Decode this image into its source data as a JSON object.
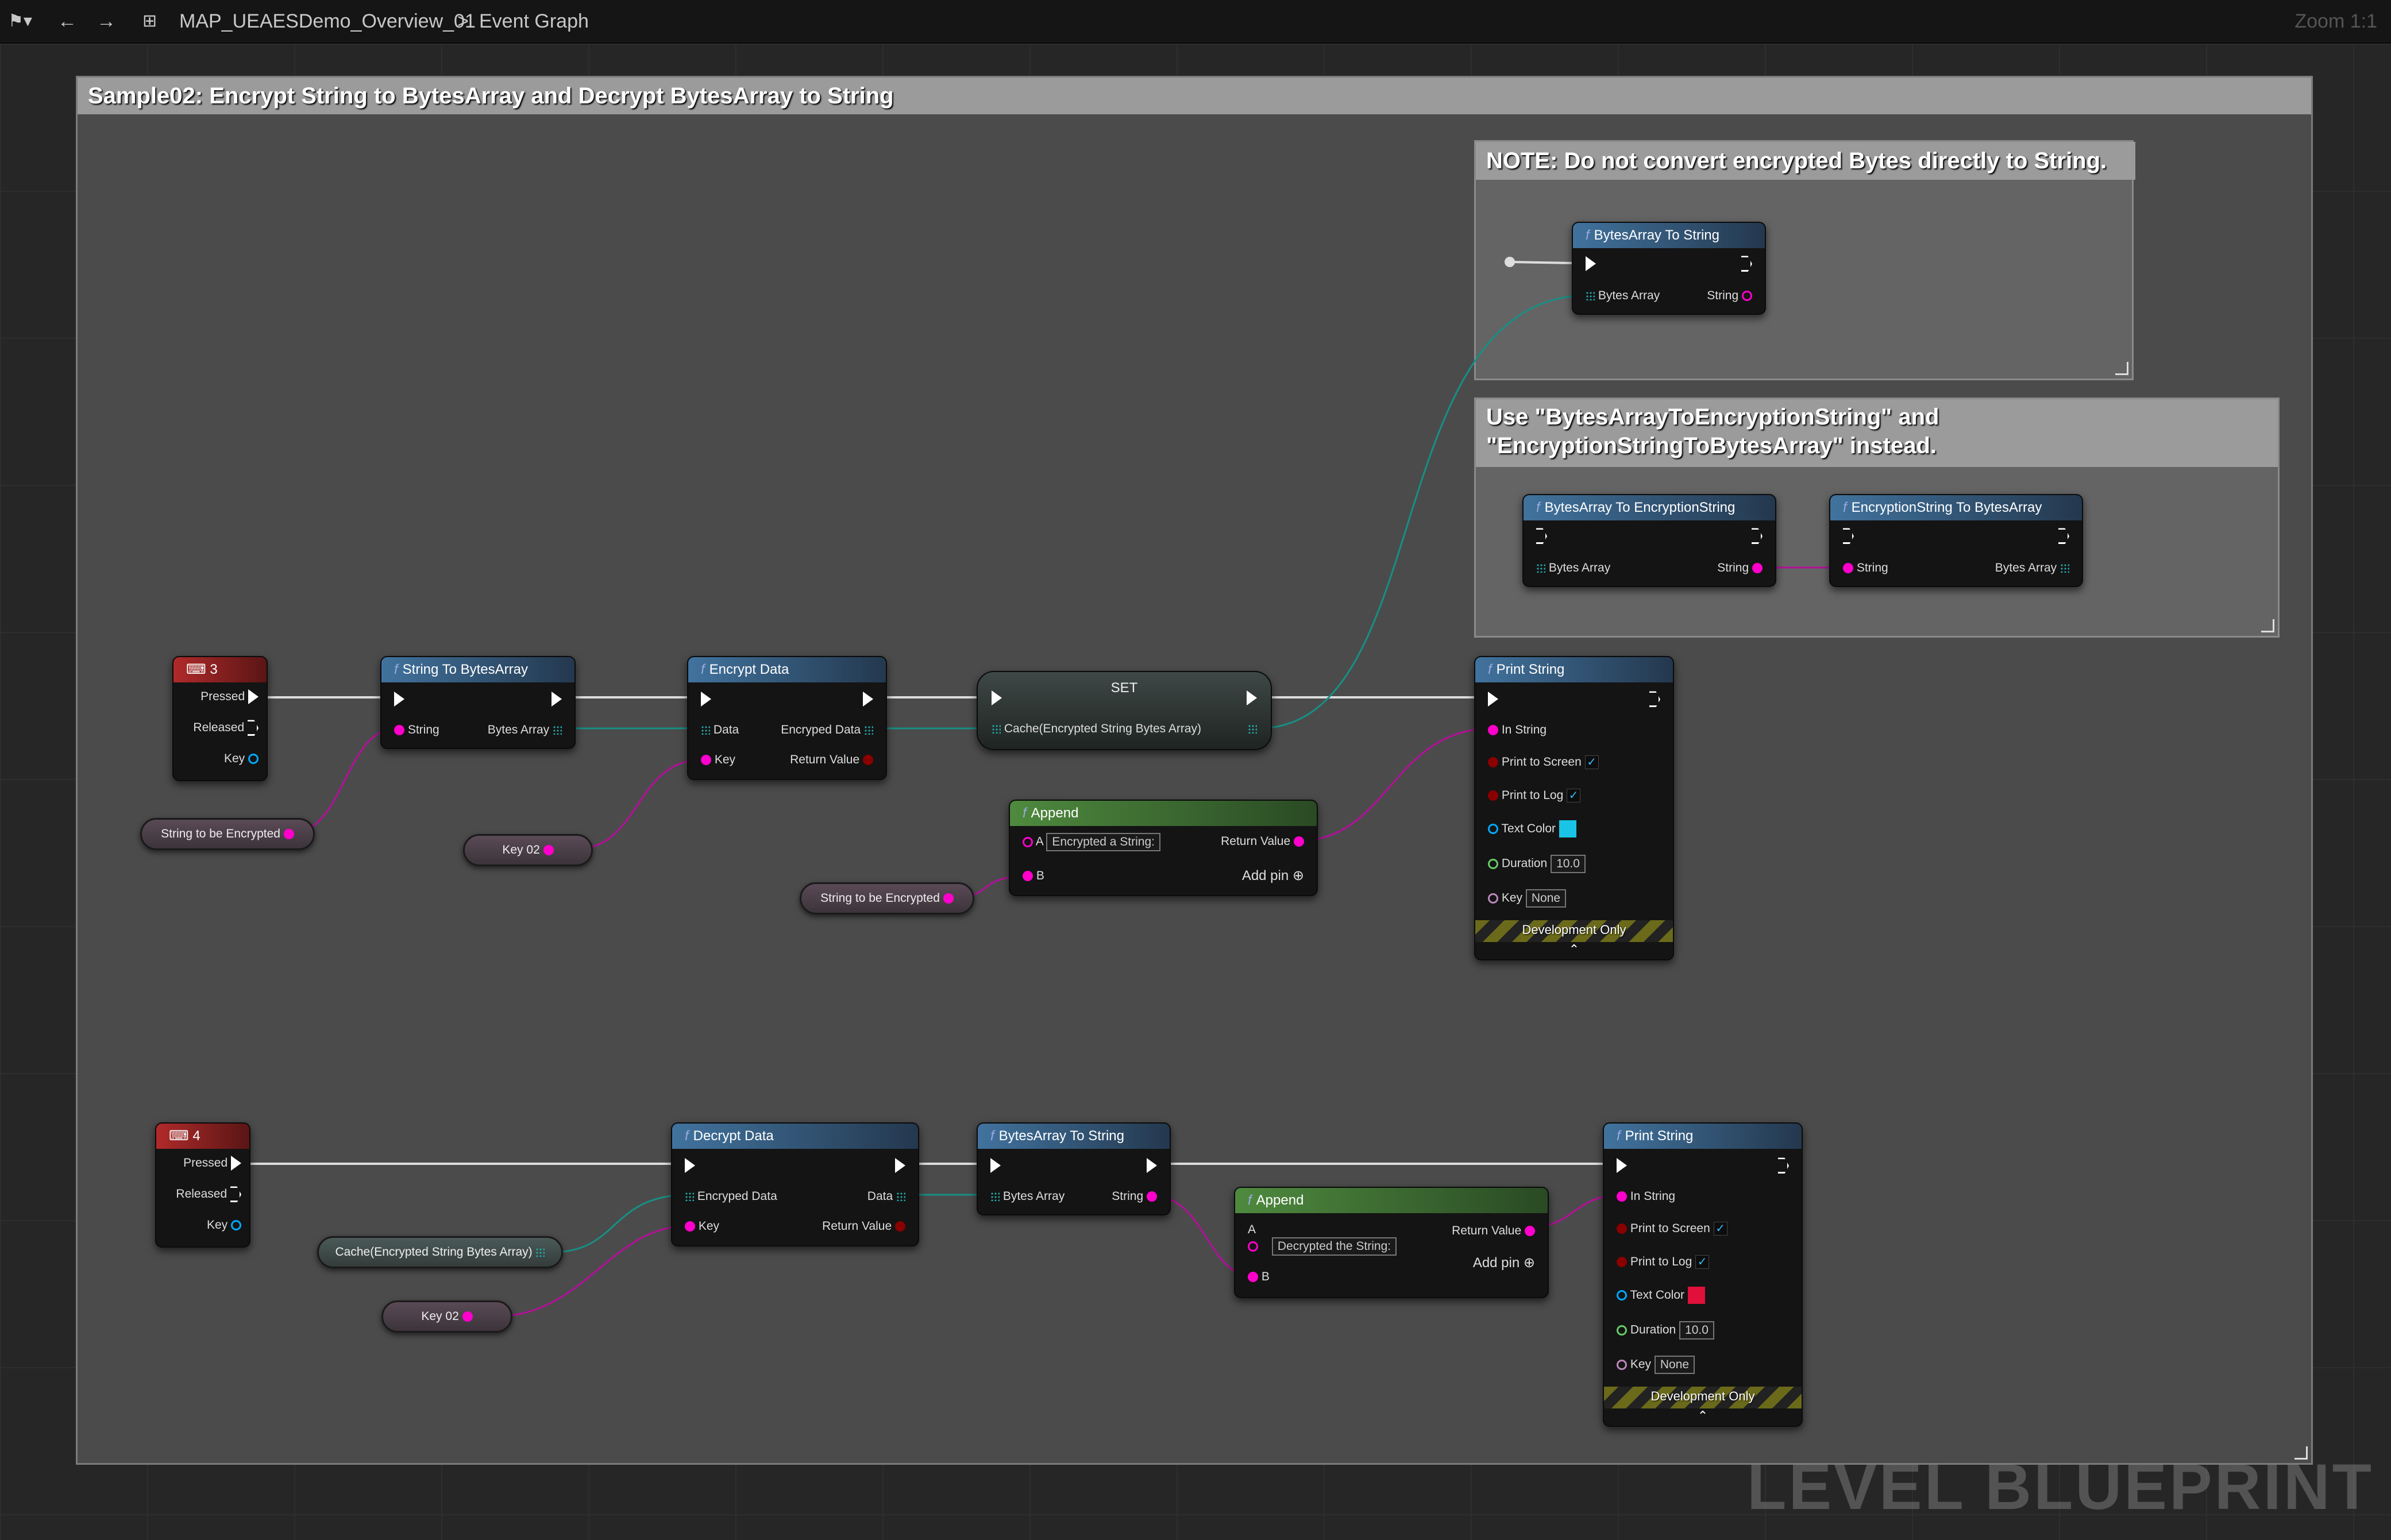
{
  "toolbar": {
    "breadcrumb_map": "MAP_UEAESDemo_Overview_01",
    "breadcrumb_sep": ">",
    "breadcrumb_graph": "Event Graph",
    "zoom": "Zoom 1:1"
  },
  "comments": {
    "main": "Sample02: Encrypt String to BytesArray and Decrypt BytesArray to String",
    "note1": "NOTE: Do not convert encrypted Bytes directly to String.",
    "note2_line1": "Use \"BytesArrayToEncryptionString\" and",
    "note2_line2": "\"EncryptionStringToBytesArray\" instead."
  },
  "nodes": {
    "event3": {
      "title": "3",
      "pressed": "Pressed",
      "released": "Released",
      "key": "Key"
    },
    "event4": {
      "title": "4",
      "pressed": "Pressed",
      "released": "Released",
      "key": "Key"
    },
    "str_to_bytes": {
      "title": "String To BytesArray",
      "in": "String",
      "out": "Bytes Array"
    },
    "encrypt": {
      "title": "Encrypt Data",
      "in_data": "Data",
      "in_key": "Key",
      "out_data": "Encryped Data",
      "out_ret": "Return Value"
    },
    "set": {
      "title": "SET",
      "pin": "Cache(Encrypted String Bytes Array)"
    },
    "append1": {
      "title": "Append",
      "a_label": "A",
      "a_value": "Encrypted a String:",
      "b_label": "B",
      "ret": "Return Value",
      "add_pin": "Add pin"
    },
    "print1": {
      "title": "Print String",
      "in_string": "In String",
      "print_screen": "Print to Screen",
      "print_log": "Print to Log",
      "text_color": "Text Color",
      "duration": "Duration",
      "duration_value": "10.0",
      "key": "Key",
      "key_value": "None",
      "dev_only": "Development Only",
      "color": "#19c4e6"
    },
    "note_b2s": {
      "title": "BytesArray To String",
      "in": "Bytes Array",
      "out": "String"
    },
    "b2es": {
      "title": "BytesArray To EncryptionString",
      "in": "Bytes Array",
      "out": "String"
    },
    "es2b": {
      "title": "EncryptionString To BytesArray",
      "in": "String",
      "out": "Bytes Array"
    },
    "decrypt": {
      "title": "Decrypt Data",
      "in_data": "Encryped Data",
      "in_key": "Key",
      "out_data": "Data",
      "out_ret": "Return Value"
    },
    "b2s": {
      "title": "BytesArray To String",
      "in": "Bytes Array",
      "out": "String"
    },
    "append2": {
      "title": "Append",
      "a_label": "A",
      "a_value": "Decrypted the String:",
      "b_label": "B",
      "ret": "Return Value",
      "add_pin": "Add pin"
    },
    "print2": {
      "title": "Print String",
      "in_string": "In String",
      "print_screen": "Print to Screen",
      "print_log": "Print to Log",
      "text_color": "Text Color",
      "duration": "Duration",
      "duration_value": "10.0",
      "key": "Key",
      "key_value": "None",
      "dev_only": "Development Only",
      "color": "#e0103a"
    }
  },
  "variables": {
    "str_enc1": "String to be Encrypted",
    "key02_a": "Key 02",
    "str_enc2": "String to be Encrypted",
    "cache": "Cache(Encrypted String Bytes Array)",
    "key02_b": "Key 02"
  },
  "watermark": "LEVEL BLUEPRINT"
}
